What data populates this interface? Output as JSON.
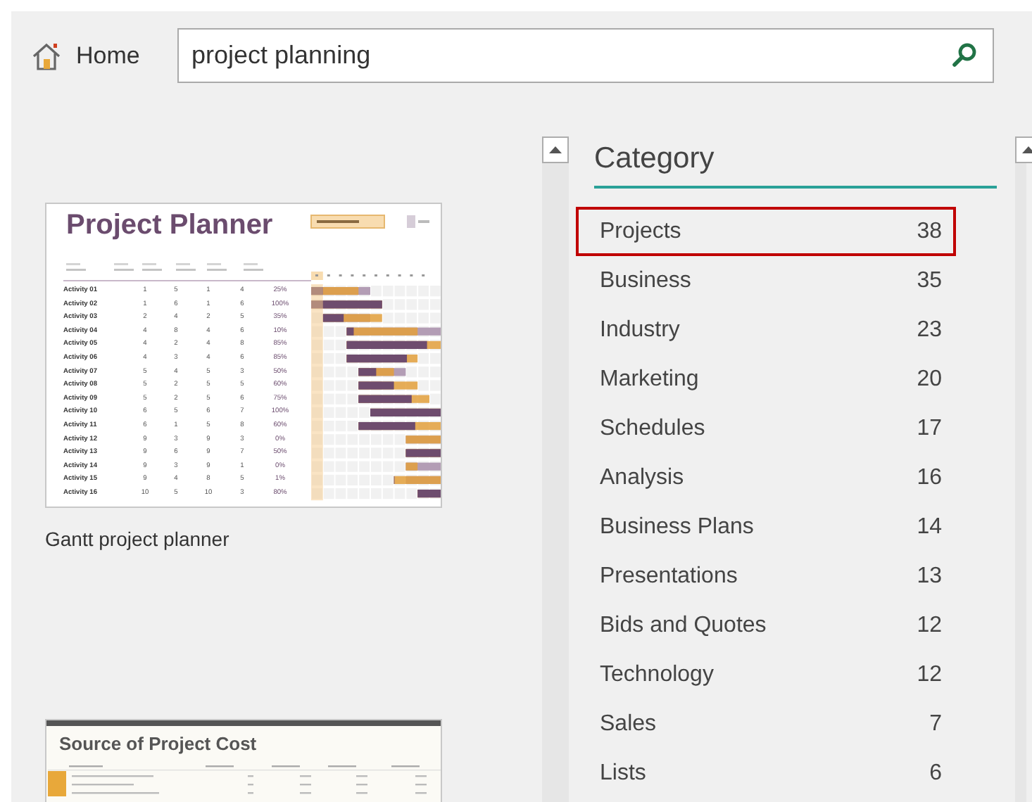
{
  "nav": {
    "home": "Home"
  },
  "search": {
    "value": "project planning"
  },
  "planner": {
    "title": "Project Planner",
    "rows": [
      [
        "Activity 01",
        "1",
        "5",
        "1",
        "4",
        "25%"
      ],
      [
        "Activity 02",
        "1",
        "6",
        "1",
        "6",
        "100%"
      ],
      [
        "Activity 03",
        "2",
        "4",
        "2",
        "5",
        "35%"
      ],
      [
        "Activity 04",
        "4",
        "8",
        "4",
        "6",
        "10%"
      ],
      [
        "Activity 05",
        "4",
        "2",
        "4",
        "8",
        "85%"
      ],
      [
        "Activity 06",
        "4",
        "3",
        "4",
        "6",
        "85%"
      ],
      [
        "Activity 07",
        "5",
        "4",
        "5",
        "3",
        "50%"
      ],
      [
        "Activity 08",
        "5",
        "2",
        "5",
        "5",
        "60%"
      ],
      [
        "Activity 09",
        "5",
        "2",
        "5",
        "6",
        "75%"
      ],
      [
        "Activity 10",
        "6",
        "5",
        "6",
        "7",
        "100%"
      ],
      [
        "Activity 11",
        "6",
        "1",
        "5",
        "8",
        "60%"
      ],
      [
        "Activity 12",
        "9",
        "3",
        "9",
        "3",
        "0%"
      ],
      [
        "Activity 13",
        "9",
        "6",
        "9",
        "7",
        "50%"
      ],
      [
        "Activity 14",
        "9",
        "3",
        "9",
        "1",
        "0%"
      ],
      [
        "Activity 15",
        "9",
        "4",
        "8",
        "5",
        "1%"
      ],
      [
        "Activity 16",
        "10",
        "5",
        "10",
        "3",
        "80%"
      ]
    ],
    "caption": "Gantt project planner"
  },
  "cost": {
    "title": "Source of Project Cost"
  },
  "category": {
    "heading": "Category",
    "items": [
      {
        "name": "Projects",
        "count": "38",
        "selected": true
      },
      {
        "name": "Business",
        "count": "35",
        "selected": false
      },
      {
        "name": "Industry",
        "count": "23",
        "selected": false
      },
      {
        "name": "Marketing",
        "count": "20",
        "selected": false
      },
      {
        "name": "Schedules",
        "count": "17",
        "selected": false
      },
      {
        "name": "Analysis",
        "count": "16",
        "selected": false
      },
      {
        "name": "Business Plans",
        "count": "14",
        "selected": false
      },
      {
        "name": "Presentations",
        "count": "13",
        "selected": false
      },
      {
        "name": "Bids and Quotes",
        "count": "12",
        "selected": false
      },
      {
        "name": "Technology",
        "count": "12",
        "selected": false
      },
      {
        "name": "Sales",
        "count": "7",
        "selected": false
      },
      {
        "name": "Lists",
        "count": "6",
        "selected": false
      }
    ]
  }
}
